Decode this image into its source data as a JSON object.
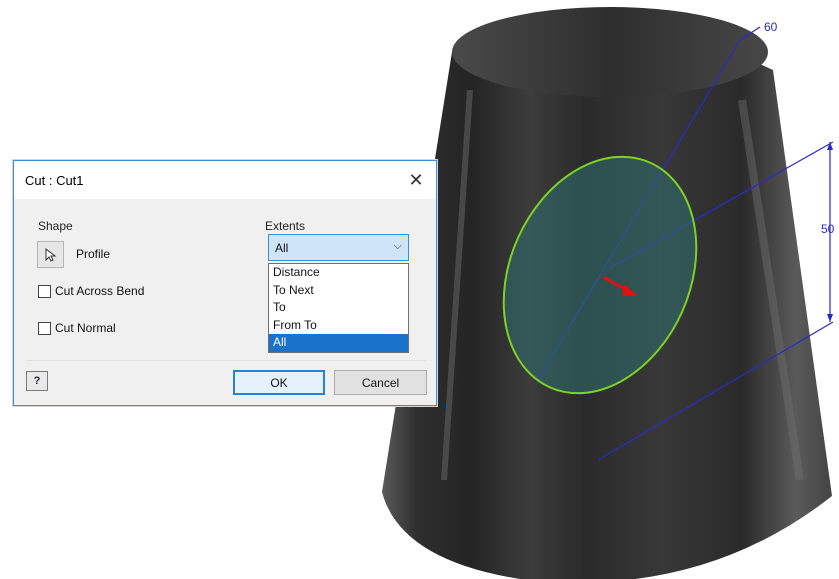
{
  "dialog": {
    "title": "Cut : Cut1",
    "shape_label": "Shape",
    "profile_label": "Profile",
    "cut_across_bend_label": "Cut Across Bend",
    "cut_normal_label": "Cut Normal",
    "extents_label": "Extents",
    "extents_selected": "All",
    "extents_options": [
      "Distance",
      "To Next",
      "To",
      "From To",
      "All"
    ],
    "help_label": "?",
    "ok_label": "OK",
    "cancel_label": "Cancel"
  },
  "viewport": {
    "dimensions": [
      "60",
      "50"
    ]
  },
  "colors": {
    "dialog_border": "#3a8fd6",
    "selection": "#1b72c9",
    "sketch_profile": "#7ed321",
    "dimension": "#2a2ac8",
    "direction_arrow": "#e01010"
  }
}
